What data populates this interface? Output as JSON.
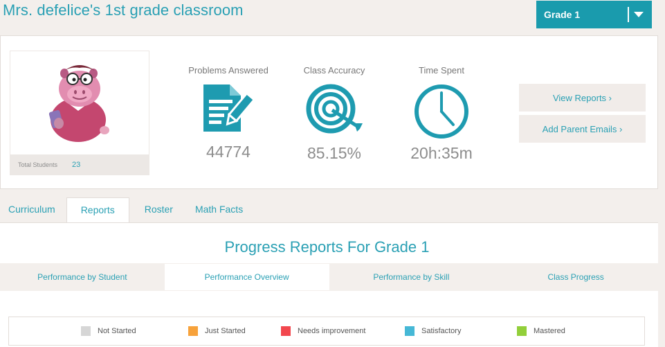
{
  "page_title": "Mrs. defelice's 1st grade classroom",
  "grade_select": {
    "value": "Grade 1"
  },
  "summary": {
    "total_students_label": "Total Students",
    "total_students_value": "23",
    "stats": [
      {
        "label": "Problems Answered",
        "value": "44774",
        "icon": "document-pencil-icon"
      },
      {
        "label": "Class Accuracy",
        "value": "85.15%",
        "icon": "target-icon"
      },
      {
        "label": "Time Spent",
        "value": "20h:35m",
        "icon": "clock-icon"
      }
    ],
    "buttons": {
      "view_reports": "View Reports ›",
      "add_parent_emails": "Add Parent Emails ›"
    }
  },
  "tabs": [
    {
      "label": "Curriculum",
      "active": false
    },
    {
      "label": "Reports",
      "active": true
    },
    {
      "label": "Roster",
      "active": false
    },
    {
      "label": "Math Facts",
      "active": false
    }
  ],
  "content": {
    "title": "Progress Reports For Grade 1",
    "subtabs": [
      {
        "label": "Performance by Student",
        "active": false
      },
      {
        "label": "Performance Overview",
        "active": true
      },
      {
        "label": "Performance by Skill",
        "active": false
      },
      {
        "label": "Class Progress",
        "active": false
      }
    ],
    "legend": [
      {
        "label": "Not Started",
        "color": "#d6d6d6"
      },
      {
        "label": "Just Started",
        "color": "#f7a23b"
      },
      {
        "label": "Needs improvement",
        "color": "#f2474e"
      },
      {
        "label": "Satisfactory",
        "color": "#46b8d6"
      },
      {
        "label": "Mastered",
        "color": "#92cf3a"
      }
    ]
  },
  "colors": {
    "accent": "#1a9bad",
    "text_accent": "#2aa0b4"
  }
}
